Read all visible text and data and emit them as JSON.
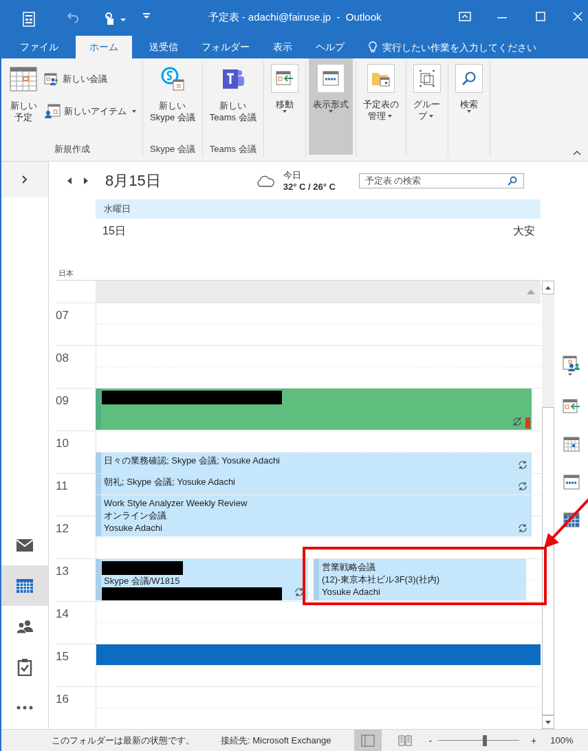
{
  "window": {
    "title": "予定表 - adachi@fairuse.jp  -  Outlook"
  },
  "tabs": [
    {
      "label": "ファイル",
      "selected": false
    },
    {
      "label": "ホーム",
      "selected": true
    },
    {
      "label": "送受信",
      "selected": false
    },
    {
      "label": "フォルダー",
      "selected": false
    },
    {
      "label": "表示",
      "selected": false
    },
    {
      "label": "ヘルプ",
      "selected": false
    }
  ],
  "tell_me": {
    "placeholder": "実行したい作業を入力してください"
  },
  "ribbon": {
    "groups": [
      {
        "label": "新規作成",
        "large": [
          {
            "kind": "appointment",
            "lines": [
              "新しい",
              "予定"
            ],
            "dropdown": false,
            "selected": false
          }
        ],
        "small": [
          {
            "kind": "meeting",
            "label": "新しい会議",
            "dropdown": false
          },
          {
            "kind": "items",
            "label": "新しいアイテム",
            "dropdown": true
          }
        ]
      },
      {
        "label": "Skype 会議",
        "large": [
          {
            "kind": "skype",
            "lines": [
              "新しい",
              "Skype 会議"
            ],
            "dropdown": false,
            "selected": false
          }
        ]
      },
      {
        "label": "Teams 会議",
        "large": [
          {
            "kind": "teams",
            "lines": [
              "新しい",
              "Teams 会議"
            ],
            "dropdown": false,
            "selected": false
          }
        ]
      },
      {
        "large": [
          {
            "kind": "move",
            "lines": [
              "移動"
            ],
            "dropdown": true,
            "selected": false
          }
        ]
      },
      {
        "large": [
          {
            "kind": "view",
            "lines": [
              "表示形式"
            ],
            "dropdown": true,
            "selected": true
          }
        ]
      },
      {
        "large": [
          {
            "kind": "manage",
            "lines": [
              "予定表の",
              "管理"
            ],
            "dropdown": true,
            "selected": false
          }
        ]
      },
      {
        "large": [
          {
            "kind": "group",
            "lines": [
              "グルー",
              "プ"
            ],
            "dropdown": true,
            "selected": false
          }
        ]
      },
      {
        "large": [
          {
            "kind": "search",
            "lines": [
              "検索"
            ],
            "dropdown": true,
            "selected": false
          }
        ]
      }
    ]
  },
  "nav": {
    "items": [
      {
        "kind": "mail",
        "selected": false
      },
      {
        "kind": "calendar",
        "selected": true
      },
      {
        "kind": "people",
        "selected": false
      },
      {
        "kind": "tasks",
        "selected": false
      },
      {
        "kind": "more",
        "selected": false
      }
    ]
  },
  "calendar": {
    "date": "8月15日",
    "weather": {
      "label": "今日",
      "temps": "32° C / 26° C"
    },
    "search": {
      "placeholder": "予定表 の検索"
    },
    "day": {
      "weekday": "水曜日",
      "date": "15日",
      "rokuyo": "大安"
    },
    "timezone": "日本",
    "hours": [
      {
        "label": "07",
        "selected": false
      },
      {
        "label": "08",
        "selected": false
      },
      {
        "label": "09",
        "selected": false,
        "events": [
          {
            "color": "#5fbe7d",
            "half_past": false,
            "half_hour": false,
            "lines": [
              {
                "kind": "redacted"
              }
            ],
            "recurring": true,
            "exception": true,
            "marker": true
          }
        ]
      },
      {
        "label": "10",
        "selected": false,
        "events": [
          {
            "color": "#c5e6fb",
            "half_past": true,
            "half_hour": true,
            "lines": [
              {
                "kind": "text",
                "text": "日々の業務確認; Skype 会議; Yosuke Adachi"
              }
            ],
            "recurring": true
          }
        ]
      },
      {
        "label": "11",
        "selected": false,
        "events": [
          {
            "color": "#c5e6fb",
            "half_past": false,
            "half_hour": true,
            "lines": [
              {
                "kind": "text",
                "text": "朝礼; Skype 会議; Yosuke Adachi"
              }
            ],
            "recurring": true
          },
          {
            "color": "#c5e6fb",
            "half_past": true,
            "half_hour": false,
            "lines": [
              {
                "kind": "text",
                "text": "Work Style Analyzer Weekly Review"
              },
              {
                "kind": "text",
                "text": "オンライン会議"
              },
              {
                "kind": "text",
                "text": "Yosuke Adachi"
              }
            ],
            "recurring": true
          }
        ]
      },
      {
        "label": "12",
        "selected": false
      },
      {
        "label": "13",
        "selected": false,
        "events": [
          {
            "color": "#c5e6fb",
            "half_past": false,
            "half_hour": false,
            "lines": [
              {
                "kind": "redacted"
              },
              {
                "kind": "text",
                "text": "Skype 会議/W1815"
              },
              {
                "kind": "redacted"
              }
            ],
            "recurring": true
          },
          {
            "color": "#c5e6fb",
            "half_past": false,
            "half_hour": false,
            "lines": [
              {
                "kind": "text",
                "text": "営業戦略会議"
              },
              {
                "kind": "text",
                "text": "(12)-東京本社ビル3F(3)(社内)"
              },
              {
                "kind": "text",
                "text": "Yosuke Adachi"
              }
            ],
            "recurring": false
          }
        ]
      },
      {
        "label": "14",
        "selected": false
      },
      {
        "label": "15",
        "selected": true
      },
      {
        "label": "16",
        "selected": false
      }
    ]
  },
  "status_bar": {
    "text": "このフォルダーは最新の状態です。",
    "connection": "接続先: Microsoft Exchange",
    "views": [
      {
        "kind": "normal",
        "selected": true
      },
      {
        "kind": "reading",
        "selected": false
      }
    ],
    "zoom": {
      "minus": "-",
      "plus": "+",
      "level": 0.55,
      "reading": "100%"
    }
  }
}
